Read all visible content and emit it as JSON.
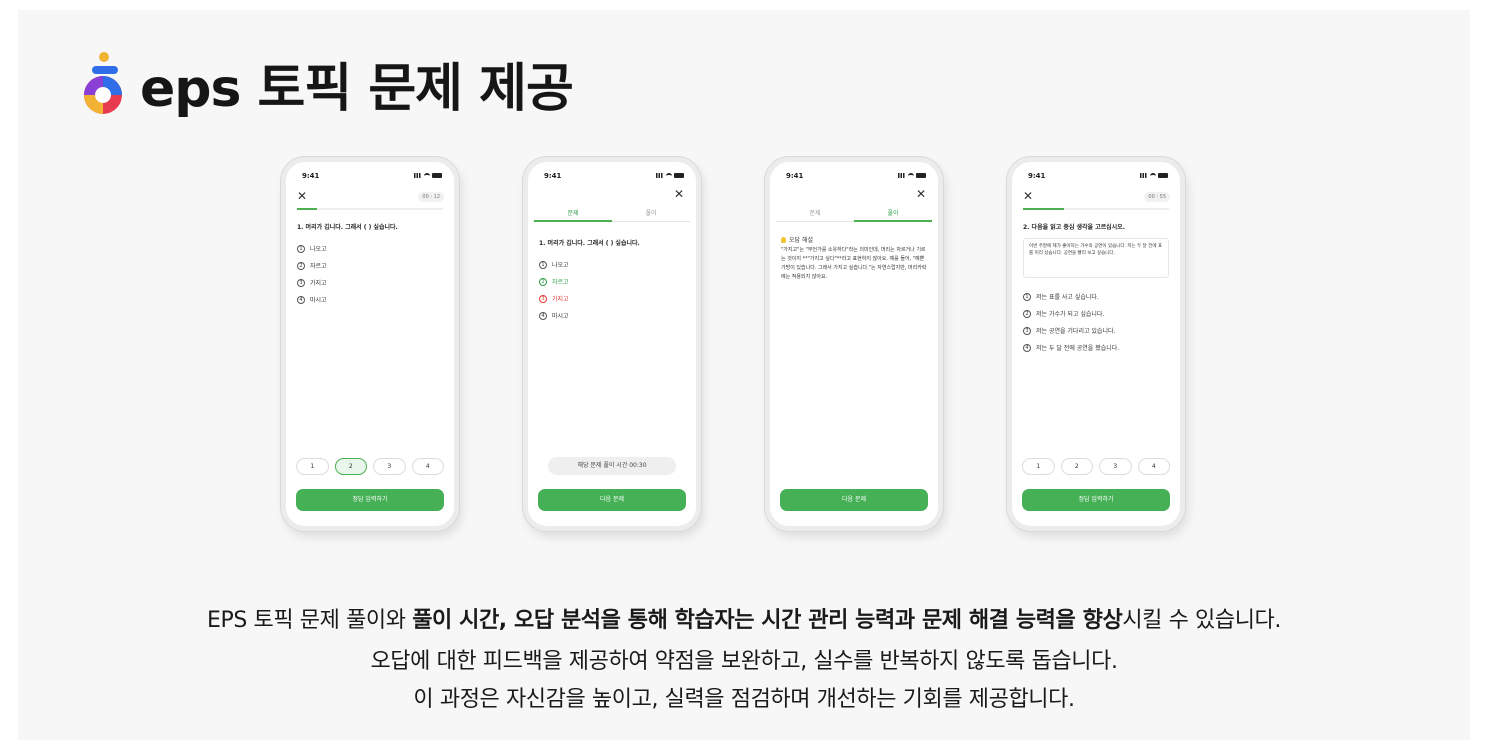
{
  "title": "eps 토픽 문제 제공",
  "phones": {
    "time": "9:41",
    "close": "✕",
    "phone1": {
      "timer": "00 : 12",
      "question": "1. 머리가 깁니다. 그래서 (  ) 싶습니다.",
      "options": [
        "나오고",
        "자르고",
        "가지고",
        "마시고"
      ],
      "choices": [
        "1",
        "2",
        "3",
        "4"
      ],
      "button": "정답 입력하기"
    },
    "phone2": {
      "tab_problem": "문제",
      "tab_solution": "풀이",
      "question": "1. 머리가 깁니다. 그래서 (  ) 싶습니다.",
      "options": [
        "나오고",
        "자르고",
        "가지고",
        "마시고"
      ],
      "time_text": "해당 문제 풀이 시간 00:30",
      "button": "다음 문제"
    },
    "phone3": {
      "tab_problem": "문제",
      "tab_solution": "풀이",
      "explain_title": "오답 해설",
      "explain_text": "\"가지고\"는 \"무언가를 소유하다\"라는 의미인데, 머리는 자르거나 기르는 것이지 **\"가지고 싶다\"**라고 표현하지 않아요. 예를 들어, \"예쁜 가방이 있습니다. 그래서 가지고 싶습니다.\"는 자연스럽지만, 머리카락에는 적용되지 않아요.",
      "button": "다음 문제"
    },
    "phone4": {
      "timer": "00 : 55",
      "question": "2. 다음을 읽고 중심 생각을 고르십시오.",
      "passage": "이번 주말에 제가 좋아하는 가수의 공연이 있습니다. 저는 두 달 전에 표를 미리 샀습니다. 공연을 빨리 보고 싶습니다.",
      "options": [
        "저는 표를 사고 싶습니다.",
        "저는 가수가 되고 싶습니다.",
        "저는 공연을 기다리고 있습니다.",
        "저는 두 달 전에 공연을 봤습니다."
      ],
      "choices": [
        "1",
        "2",
        "3",
        "4"
      ],
      "button": "정답 입력하기"
    }
  },
  "description": {
    "line1_pre": "EPS 토픽 문제 풀이와 ",
    "line1_bold1": "풀이 시간, 오답 분석을 통해  학습자는 시간 관리 능력과 문제 해결 능력을 향상",
    "line1_post": "시킬 수 있습니다.",
    "line2": "오답에 대한 피드백을 제공하여 약점을 보완하고, 실수를 반복하지 않도록 돕습니다.",
    "line3": "이 과정은 자신감을 높이고, 실력을 점검하며 개선하는 기회를 제공합니다."
  },
  "colors": {
    "accent": "#46b057",
    "wrong": "#e53935",
    "bg": "#f7f7f7"
  }
}
